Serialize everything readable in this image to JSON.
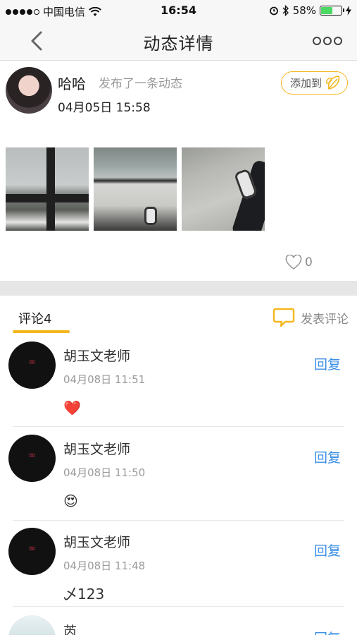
{
  "status_bar": {
    "carrier": "中国电信",
    "time": "16:54",
    "battery": "58%",
    "battery_level": 0.58
  },
  "nav": {
    "title": "动态详情"
  },
  "post": {
    "author": "哈哈",
    "action": "发布了一条动态",
    "time": "04月05日 15:58",
    "add_to_label": "添加到",
    "like_count": "0"
  },
  "comments_section": {
    "tab_label": "评论4",
    "post_comment_label": "发表评论"
  },
  "comments": [
    {
      "name": "胡玉文老师",
      "time": "04月08日 11:51",
      "reply_label": "回复",
      "content": "❤️"
    },
    {
      "name": "胡玉文老师",
      "time": "04月08日 11:50",
      "reply_label": "回复",
      "content": "😍"
    },
    {
      "name": "胡玉文老师",
      "time": "04月08日 11:48",
      "reply_label": "回复",
      "content": "乄123"
    },
    {
      "name": "芮",
      "time": "",
      "reply_label": "回复",
      "content": ""
    }
  ],
  "colors": {
    "accent": "#f5b71f",
    "link": "#3a8ee6",
    "battery": "#4cd964"
  },
  "icons": [
    "back-chevron-icon",
    "more-dots-icon",
    "leaf-icon",
    "heart-outline-icon",
    "comment-bubble-icon",
    "wifi-icon",
    "alarm-icon",
    "bluetooth-icon",
    "charging-icon"
  ]
}
